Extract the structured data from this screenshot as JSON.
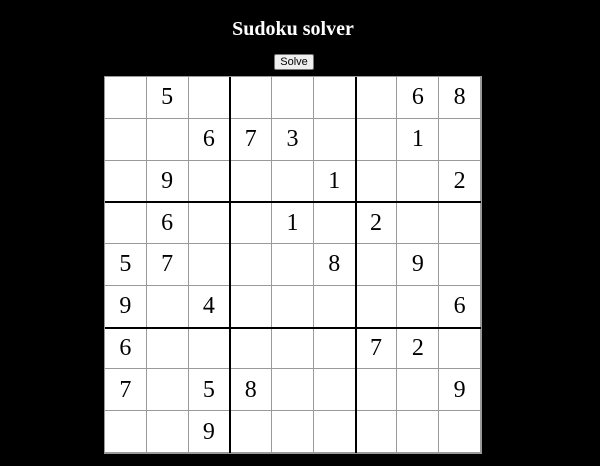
{
  "header": {
    "title": "Sudoku solver"
  },
  "toolbar": {
    "solve_label": "Solve"
  },
  "board": {
    "rows": [
      [
        "",
        "5",
        "",
        "",
        "",
        "",
        "",
        "6",
        "8"
      ],
      [
        "",
        "",
        "6",
        "7",
        "3",
        "",
        "",
        "1",
        ""
      ],
      [
        "",
        "9",
        "",
        "",
        "",
        "1",
        "",
        "",
        "2"
      ],
      [
        "",
        "6",
        "",
        "",
        "1",
        "",
        "2",
        "",
        ""
      ],
      [
        "5",
        "7",
        "",
        "",
        "",
        "8",
        "",
        "9",
        ""
      ],
      [
        "9",
        "",
        "4",
        "",
        "",
        "",
        "",
        "",
        "6"
      ],
      [
        "6",
        "",
        "",
        "",
        "",
        "",
        "7",
        "2",
        ""
      ],
      [
        "7",
        "",
        "5",
        "8",
        "",
        "",
        "",
        "",
        "9"
      ],
      [
        "",
        "",
        "9",
        "",
        "",
        "",
        "",
        "",
        ""
      ]
    ]
  }
}
